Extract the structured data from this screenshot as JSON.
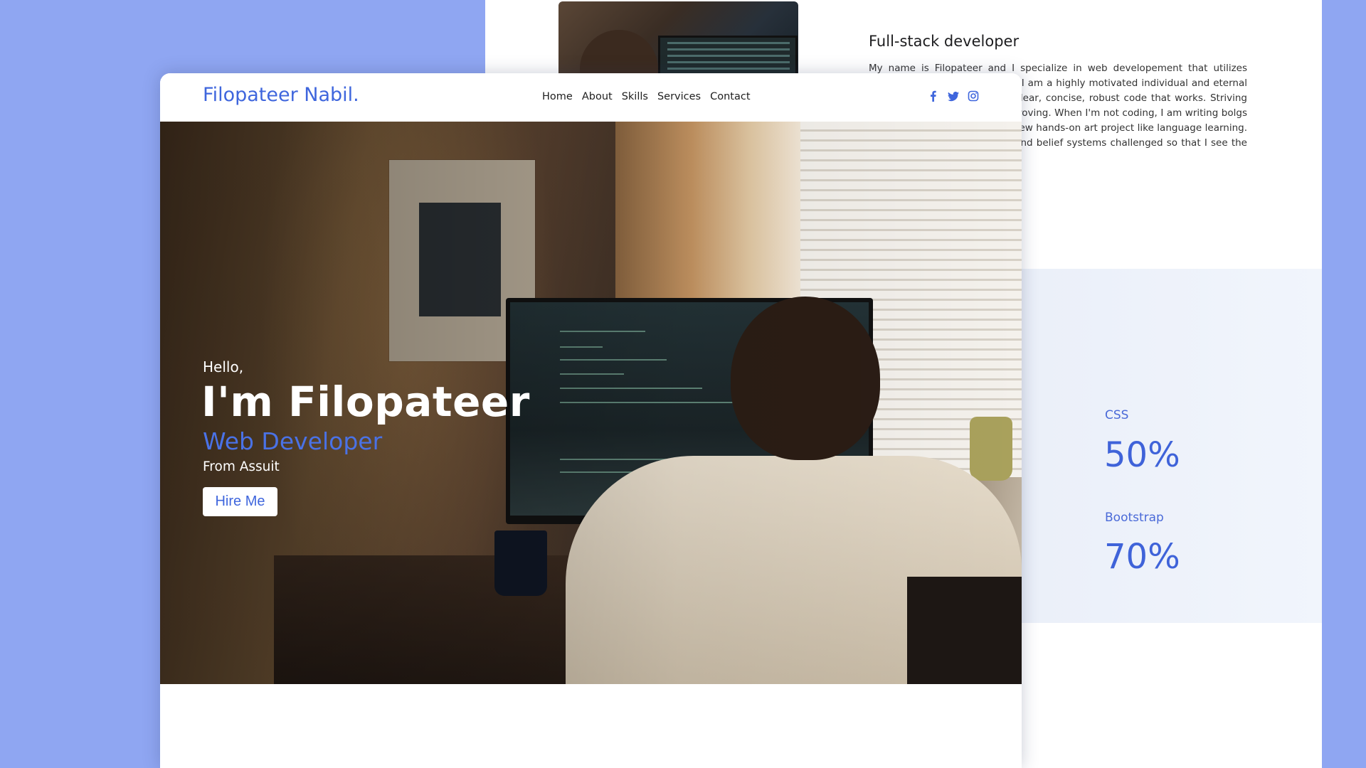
{
  "about": {
    "heading": "Full-stack developer",
    "paragraph": "My name is Filopateer and I specialize in web developement that utilizes HTML, CSS, JS, and REACT etc. I am a highly motivated individual and eternal optimist dedicated to writing clear, concise, robust code that works. Striving to never stop learning and improving. When I'm not coding, I am writing bolgs , reading, or picking up some new hands-on art project like language learning. I like to have my perspective and belief systems challenged so that I see the world through new eyes."
  },
  "skills": [
    {
      "name": "CSS",
      "value": "50%",
      "level": 0.5
    },
    {
      "name": "Bootstrap",
      "value": "70%",
      "level": 0.7
    }
  ],
  "navbar": {
    "brand": "Filopateer Nabil.",
    "links": [
      "Home",
      "About",
      "Skills",
      "Services",
      "Contact"
    ],
    "socials": [
      "facebook-icon",
      "twitter-icon",
      "instagram-icon"
    ]
  },
  "hero": {
    "greeting": "Hello,",
    "name": "I'm Filopateer",
    "role": "Web Developer",
    "location": "From Assuit",
    "button": "Hire Me"
  },
  "colors": {
    "background": "#8fa6f2",
    "accent": "#3f66dd",
    "text": "#1e1e1e"
  }
}
